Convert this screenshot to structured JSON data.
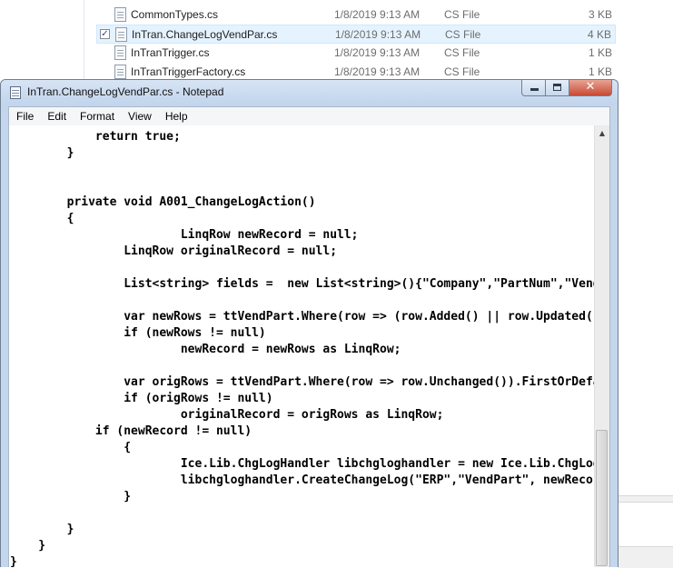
{
  "explorer": {
    "files": [
      {
        "name": "CommonTypes.cs",
        "date": "1/8/2019 9:13 AM",
        "type": "CS File",
        "size": "3 KB",
        "selected": false
      },
      {
        "name": "InTran.ChangeLogVendPar.cs",
        "date": "1/8/2019 9:13 AM",
        "type": "CS File",
        "size": "4 KB",
        "selected": true
      },
      {
        "name": "InTranTrigger.cs",
        "date": "1/8/2019 9:13 AM",
        "type": "CS File",
        "size": "1 KB",
        "selected": false
      },
      {
        "name": "InTranTriggerFactory.cs",
        "date": "1/8/2019 9:13 AM",
        "type": "CS File",
        "size": "1 KB",
        "selected": false
      }
    ],
    "checkbox_glyph": "✓"
  },
  "notepad": {
    "title": "InTran.ChangeLogVendPar.cs - Notepad",
    "controls": {
      "close_glyph": "✕"
    },
    "menu": [
      "File",
      "Edit",
      "Format",
      "View",
      "Help"
    ],
    "scroll_up_glyph": "▲",
    "code": "            return true;\n        }\n\n\n        private void A001_ChangeLogAction()\n        {\n                        LinqRow newRecord = null;\n                LinqRow originalRecord = null;\n\n                List<string> fields =  new List<string>(){\"Company\",\"PartNum\",\"VendorNum\"};\n\n                var newRows = ttVendPart.Where(row => (row.Added() || row.Updated()));\n                if (newRows != null)\n                        newRecord = newRows as LinqRow;\n\n                var origRows = ttVendPart.Where(row => row.Unchanged()).FirstOrDefault();\n                if (origRows != null)\n                        originalRecord = origRows as LinqRow;\n            if (newRecord != null)\n                {\n                        Ice.Lib.ChgLogHandler libchgloghandler = new Ice.Lib.ChgLogHandler(Db);\n                        libchgloghandler.CreateChangeLog(\"ERP\",\"VendPart\", newRecord, originalRecord, fields);\n                }\n\n        }\n    }\n}"
  }
}
